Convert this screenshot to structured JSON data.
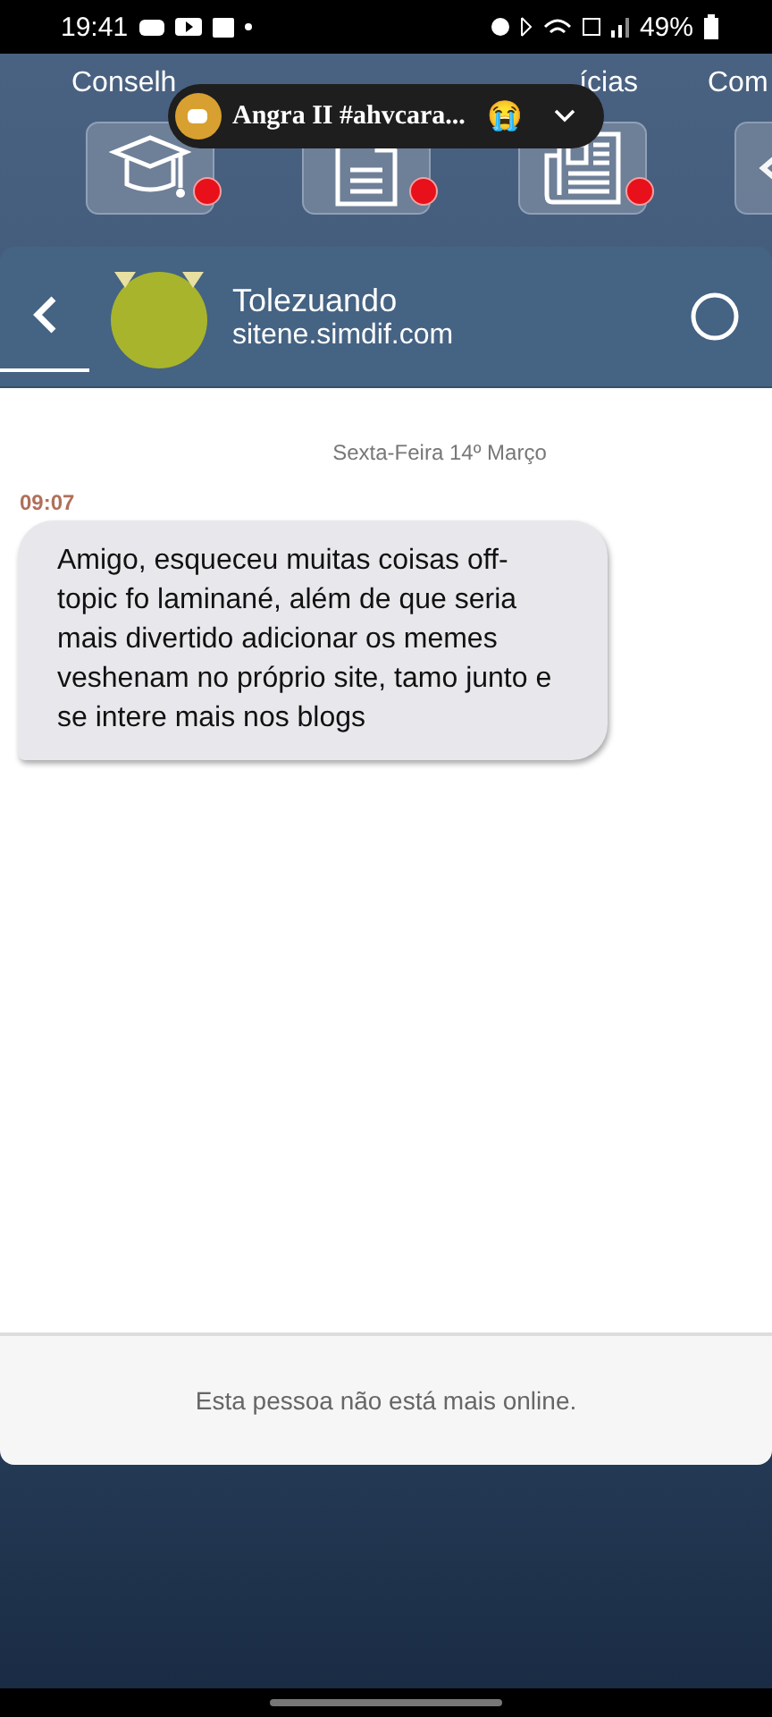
{
  "status_bar": {
    "time": "19:41",
    "battery": "49%"
  },
  "notification": {
    "title": "Angra II #ahvcara...",
    "emoji": "😭"
  },
  "nav": [
    {
      "label": "Conselh",
      "badge": true
    },
    {
      "badge": true
    },
    {
      "label": "ícias",
      "badge": true
    },
    {
      "label": "Com",
      "badge": false
    }
  ],
  "chat_header": {
    "name": "Tolezuando",
    "site": "sitene.simdif.com"
  },
  "date_divider": "Sexta-Feira 14º Março",
  "messages": [
    {
      "time": "09:07",
      "text": "Amigo, esqueceu muitas coisas off-topic fo laminané, além de que seria mais divertido adicionar os memes veshenam no próprio site, tamo junto e se intere mais nos blogs"
    }
  ],
  "footer": {
    "notice": "Esta pessoa não está mais online."
  }
}
